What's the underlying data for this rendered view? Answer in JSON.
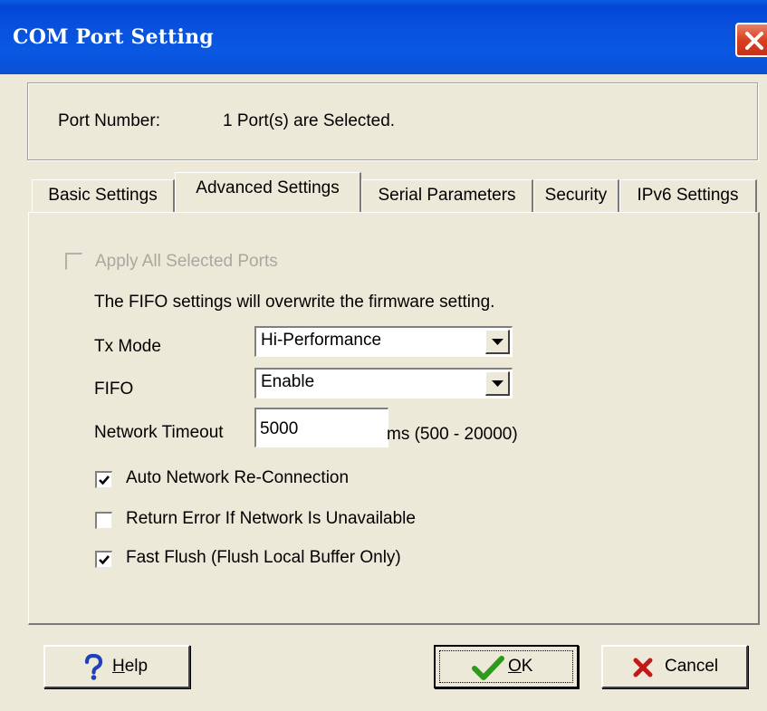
{
  "window": {
    "title": "COM Port Setting"
  },
  "port": {
    "label": "Port Number:",
    "value": "1 Port(s) are Selected."
  },
  "tabs": [
    {
      "label": "Basic Settings",
      "active": false
    },
    {
      "label": "Advanced Settings",
      "active": true
    },
    {
      "label": "Serial Parameters",
      "active": false
    },
    {
      "label": "Security",
      "active": false
    },
    {
      "label": "IPv6 Settings",
      "active": false
    }
  ],
  "advanced": {
    "apply_all": {
      "label": "Apply All Selected Ports",
      "checked": false,
      "enabled": false
    },
    "fifo_note": "The FIFO settings will overwrite the firmware setting.",
    "tx_mode": {
      "label": "Tx Mode",
      "value": "Hi-Performance"
    },
    "fifo": {
      "label": "FIFO",
      "value": "Enable"
    },
    "network_timeout": {
      "label": "Network Timeout",
      "value": "5000",
      "unit_range": "ms (500 - 20000)"
    },
    "auto_reconnect": {
      "label": "Auto Network Re-Connection",
      "checked": true
    },
    "return_error": {
      "label": "Return Error If Network Is Unavailable",
      "checked": false
    },
    "fast_flush": {
      "label": "Fast Flush (Flush Local Buffer Only)",
      "checked": true
    }
  },
  "buttons": {
    "help": {
      "label_mnemonic": "H",
      "label_rest": "elp"
    },
    "ok": {
      "label_mnemonic": "O",
      "label_rest": "K"
    },
    "cancel": {
      "label": "Cancel"
    }
  },
  "colors": {
    "titlebar": "#0852dd",
    "dialog_bg": "#ece9d8",
    "close": "#d9411f"
  }
}
